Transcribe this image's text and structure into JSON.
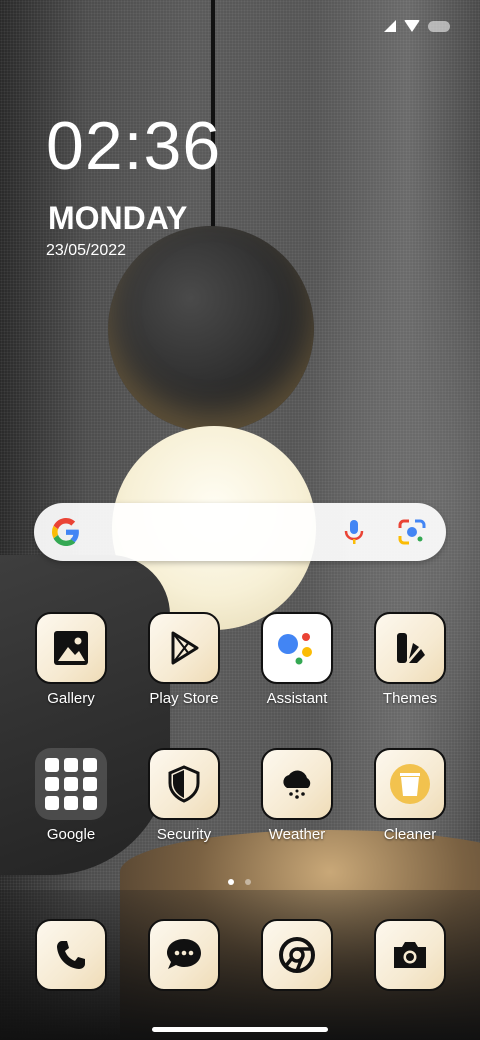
{
  "status": {
    "icons": [
      "signal-icon",
      "wifi-icon",
      "battery-icon"
    ]
  },
  "clock": {
    "time": "02:36",
    "day": "MONDAY",
    "date": "23/05/2022"
  },
  "search": {
    "icons": [
      "google-g-icon",
      "mic-icon",
      "lens-icon"
    ]
  },
  "apps": [
    {
      "label": "Gallery",
      "icon": "gallery-icon"
    },
    {
      "label": "Play Store",
      "icon": "play-store-icon"
    },
    {
      "label": "Assistant",
      "icon": "assistant-icon"
    },
    {
      "label": "Themes",
      "icon": "themes-icon"
    },
    {
      "label": "Google",
      "icon": "google-folder-icon"
    },
    {
      "label": "Security",
      "icon": "shield-icon"
    },
    {
      "label": "Weather",
      "icon": "weather-cloud-icon"
    },
    {
      "label": "Cleaner",
      "icon": "trash-icon"
    }
  ],
  "dock": [
    {
      "icon": "phone-icon"
    },
    {
      "icon": "messages-icon"
    },
    {
      "icon": "chrome-icon"
    },
    {
      "icon": "camera-icon"
    }
  ],
  "pager": {
    "current": 1,
    "total": 2
  },
  "colors": {
    "icon_bg": "#f6ead2",
    "icon_border": "#111111",
    "text": "#ffffff"
  }
}
